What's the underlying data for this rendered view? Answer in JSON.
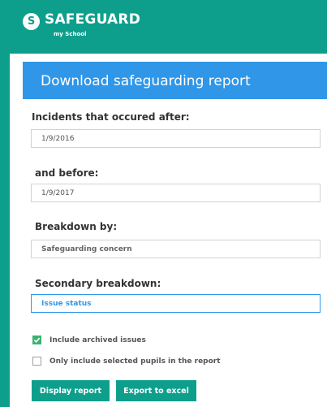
{
  "header": {
    "brand": "SAFEGUARD",
    "sub_brand": "my School",
    "logo_letter": "S"
  },
  "report": {
    "title": "Download safeguarding report",
    "after_label": "Incidents that occured after:",
    "after_value": "1/9/2016",
    "before_label": "and before:",
    "before_value": "1/9/2017",
    "breakdown_label": "Breakdown by:",
    "breakdown_value": "Safeguarding concern",
    "secondary_label": "Secondary breakdown:",
    "secondary_value": "Issue status",
    "include_archived_label": "Include archived issues",
    "include_archived_checked": true,
    "selected_pupils_label": "Only include selected pupils in the report",
    "selected_pupils_checked": false,
    "display_button": "Display report",
    "export_button": "Export to excel"
  },
  "colors": {
    "brand_teal": "#0e9f8c",
    "title_blue": "#2f96e8",
    "check_green": "#3bb273"
  }
}
